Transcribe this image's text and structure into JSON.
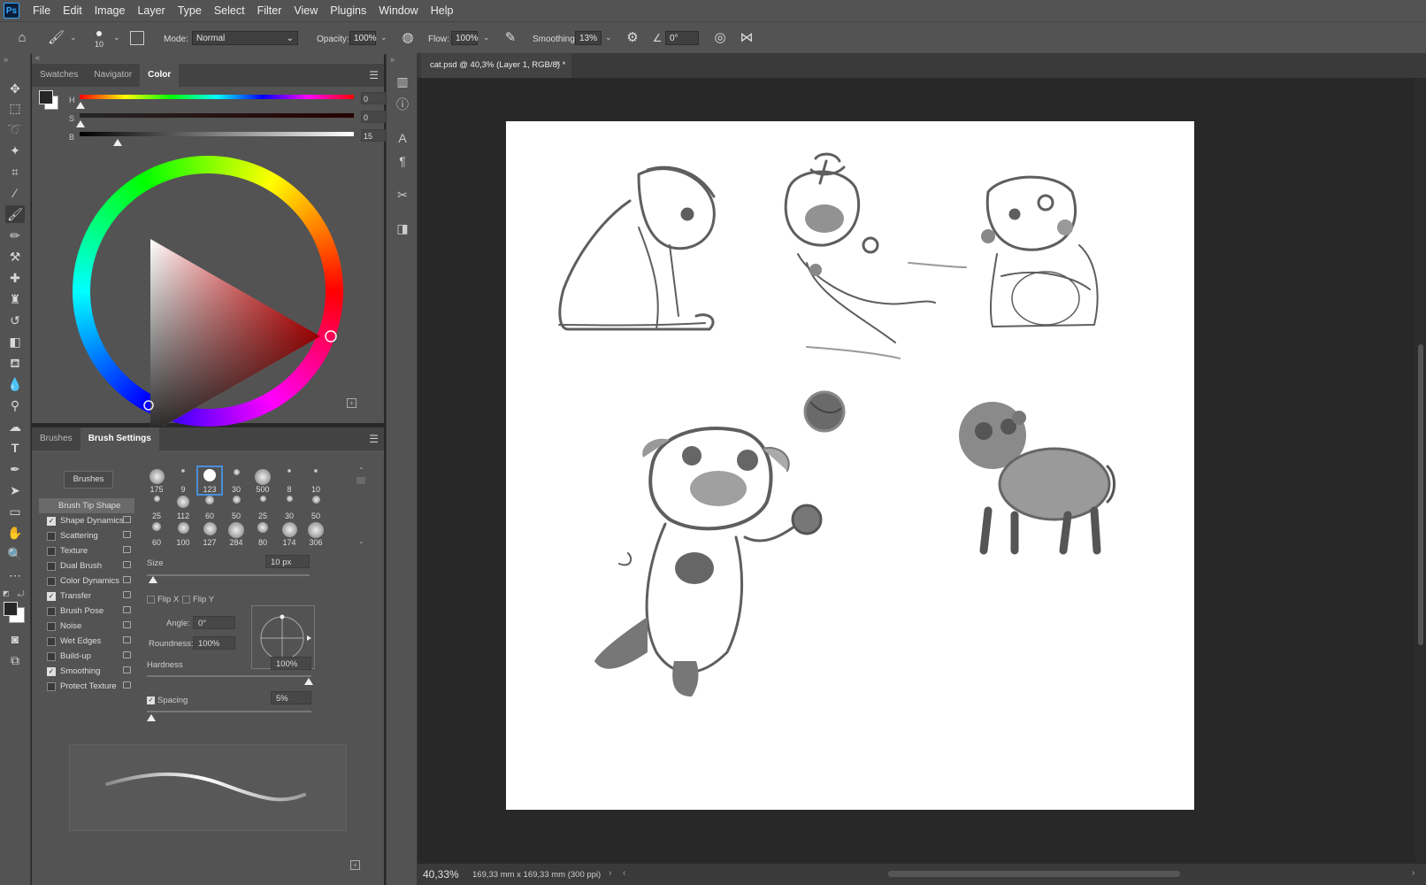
{
  "menubar": {
    "logo": "Ps",
    "items": [
      "File",
      "Edit",
      "Image",
      "Layer",
      "Type",
      "Select",
      "Filter",
      "View",
      "Plugins",
      "Window",
      "Help"
    ]
  },
  "options": {
    "brush_size": "10",
    "mode_label": "Mode:",
    "mode_value": "Normal",
    "opacity_label": "Opacity:",
    "opacity_value": "100%",
    "flow_label": "Flow:",
    "flow_value": "100%",
    "smoothing_label": "Smoothing:",
    "smoothing_value": "13%",
    "angle_value": "0°"
  },
  "color_panel": {
    "tabs": [
      "Swatches",
      "Navigator",
      "Color"
    ],
    "active_tab": "Color",
    "h_label": "H",
    "h_value": "0",
    "h_unit": "°",
    "s_label": "S",
    "s_value": "0",
    "s_unit": "%",
    "b_label": "B",
    "b_value": "15",
    "b_unit": "%",
    "hue_marker_deg": 0,
    "brightness": 0.15
  },
  "brush_panel": {
    "tabs": [
      "Brushes",
      "Brush Settings"
    ],
    "active_tab": "Brush Settings",
    "brushes_button": "Brushes",
    "settings": [
      {
        "label": "Brush Tip Shape",
        "checkbox": false,
        "selected": true
      },
      {
        "label": "Shape Dynamics",
        "checkbox": true,
        "checked": true
      },
      {
        "label": "Scattering",
        "checkbox": true,
        "checked": false
      },
      {
        "label": "Texture",
        "checkbox": true,
        "checked": false
      },
      {
        "label": "Dual Brush",
        "checkbox": true,
        "checked": false
      },
      {
        "label": "Color Dynamics",
        "checkbox": true,
        "checked": false
      },
      {
        "label": "Transfer",
        "checkbox": true,
        "checked": true
      },
      {
        "label": "Brush Pose",
        "checkbox": true,
        "checked": false
      },
      {
        "label": "Noise",
        "checkbox": true,
        "checked": false
      },
      {
        "label": "Wet Edges",
        "checkbox": true,
        "checked": false
      },
      {
        "label": "Build-up",
        "checkbox": true,
        "checked": false
      },
      {
        "label": "Smoothing",
        "checkbox": true,
        "checked": true
      },
      {
        "label": "Protect Texture",
        "checkbox": true,
        "checked": false
      }
    ],
    "brush_sizes": [
      "175",
      "9",
      "123",
      "30",
      "500",
      "8",
      "10",
      "25",
      "112",
      "60",
      "50",
      "25",
      "30",
      "50",
      "60",
      "100",
      "127",
      "284",
      "80",
      "174",
      "306"
    ],
    "selected_brush": 2,
    "size_label": "Size",
    "size_value": "10 px",
    "flip_x": "Flip X",
    "flip_y": "Flip Y",
    "angle_label": "Angle:",
    "angle_value": "0°",
    "roundness_label": "Roundness:",
    "roundness_value": "100%",
    "hardness_label": "Hardness",
    "hardness_value": "100%",
    "spacing_label": "Spacing",
    "spacing_value": "5%"
  },
  "document": {
    "tab_title": "cat.psd @ 40,3% (Layer 1, RGB/8) *",
    "zoom": "40,33%",
    "doc_info": "169,33 mm x 169,33 mm (300 ppi)"
  },
  "colors": {
    "ui_bg": "#535353",
    "workspace": "#282828",
    "canvas": "#ffffff",
    "sketch": "#5a5a5a",
    "selected_brush": "#4a8fd8"
  },
  "icons": {
    "home": "home-icon",
    "brush": "brush-icon",
    "airbrush": "airbrush-icon",
    "settings": "gear-icon",
    "angle": "angle-icon",
    "pressure": "pressure-icon",
    "symmetry": "butterfly-icon"
  }
}
